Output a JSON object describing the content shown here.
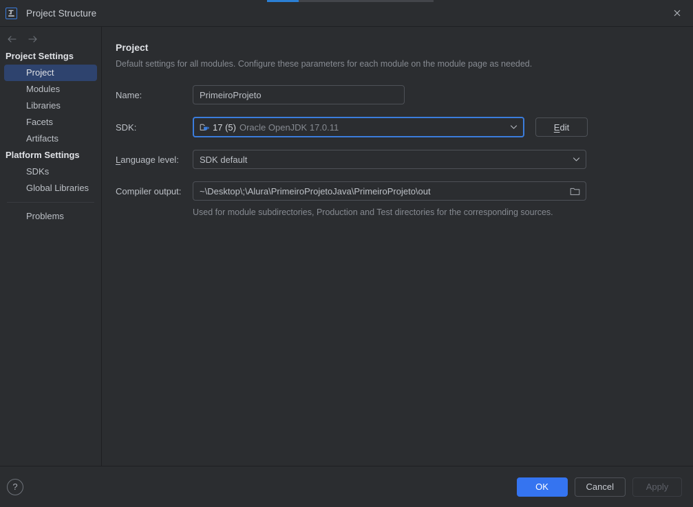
{
  "window": {
    "title": "Project Structure",
    "app_icon": "intellij-idea-icon",
    "close_icon": "close-icon"
  },
  "progress": {
    "visible": true,
    "percent": 19,
    "accent_color": "#2b7fd4"
  },
  "navigation": {
    "back_icon": "arrow-left-icon",
    "forward_icon": "arrow-right-icon"
  },
  "sidebar": {
    "groups": [
      {
        "title": "Project Settings",
        "items": [
          {
            "label": "Project",
            "selected": true
          },
          {
            "label": "Modules",
            "selected": false
          },
          {
            "label": "Libraries",
            "selected": false
          },
          {
            "label": "Facets",
            "selected": false
          },
          {
            "label": "Artifacts",
            "selected": false
          }
        ]
      },
      {
        "title": "Platform Settings",
        "items": [
          {
            "label": "SDKs",
            "selected": false
          },
          {
            "label": "Global Libraries",
            "selected": false
          }
        ]
      }
    ],
    "extra": [
      {
        "label": "Problems",
        "selected": false
      }
    ],
    "selection_color": "#2e436e"
  },
  "main": {
    "title": "Project",
    "description": "Default settings for all modules. Configure these parameters for each module on the module page as needed.",
    "name_field": {
      "label": "Name:",
      "value": "PrimeiroProjeto",
      "placeholder": ""
    },
    "sdk_field": {
      "label": "SDK:",
      "icon": "jdk-icon",
      "version": "17 (5)",
      "vendor": "Oracle OpenJDK 17.0.11",
      "chevron_icon": "chevron-down-icon",
      "focused": true,
      "focus_color": "#3b7ddd",
      "edit_button": {
        "label": "Edit",
        "mnemonic": "E"
      }
    },
    "language_level_field": {
      "label": "Language level:",
      "mnemonic": "L",
      "value": "SDK default",
      "chevron_icon": "chevron-down-icon"
    },
    "compiler_output_field": {
      "label": "Compiler output:",
      "value": "~\\Desktop\\;\\Alura\\PrimeiroProjetoJava\\PrimeiroProjeto\\out",
      "placeholder": "",
      "browse_icon": "folder-icon",
      "hint": "Used for module subdirectories, Production and Test directories for the corresponding sources."
    }
  },
  "footer": {
    "help_label": "?",
    "help_icon": "question-mark-icon",
    "buttons": [
      {
        "label": "OK",
        "style": "primary",
        "enabled": true
      },
      {
        "label": "Cancel",
        "style": "default",
        "enabled": true
      },
      {
        "label": "Apply",
        "style": "disabled",
        "enabled": false
      }
    ],
    "primary_color": "#3574f0"
  }
}
